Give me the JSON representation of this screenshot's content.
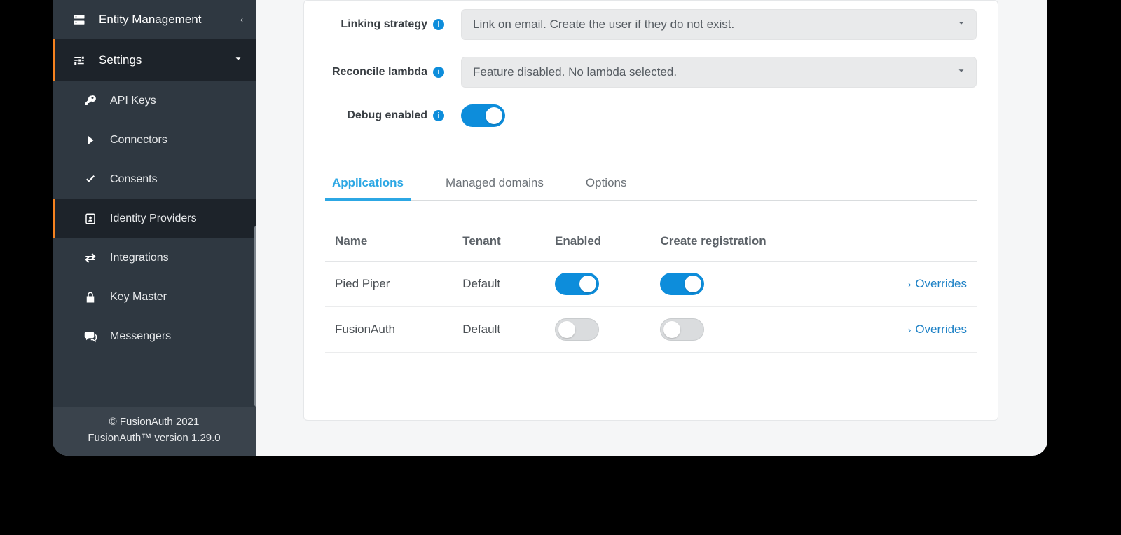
{
  "sidebar": {
    "entity_management": "Entity Management",
    "settings": "Settings",
    "items": {
      "api_keys": "API Keys",
      "connectors": "Connectors",
      "consents": "Consents",
      "identity_providers": "Identity Providers",
      "integrations": "Integrations",
      "key_master": "Key Master",
      "messengers": "Messengers"
    },
    "footer": {
      "copyright": "© FusionAuth 2021",
      "version": "FusionAuth™ version 1.29.0"
    }
  },
  "form": {
    "linking_strategy": {
      "label": "Linking strategy",
      "value": "Link on email. Create the user if they do not exist."
    },
    "reconcile_lambda": {
      "label": "Reconcile lambda",
      "value": "Feature disabled. No lambda selected."
    },
    "debug_enabled": {
      "label": "Debug enabled"
    }
  },
  "tabs": {
    "applications": "Applications",
    "managed_domains": "Managed domains",
    "options": "Options"
  },
  "table": {
    "headers": {
      "name": "Name",
      "tenant": "Tenant",
      "enabled": "Enabled",
      "create_registration": "Create registration"
    },
    "rows": [
      {
        "name": "Pied Piper",
        "tenant": "Default",
        "enabled": true,
        "create_registration": true
      },
      {
        "name": "FusionAuth",
        "tenant": "Default",
        "enabled": false,
        "create_registration": false
      }
    ],
    "overrides_label": "Overrides"
  }
}
